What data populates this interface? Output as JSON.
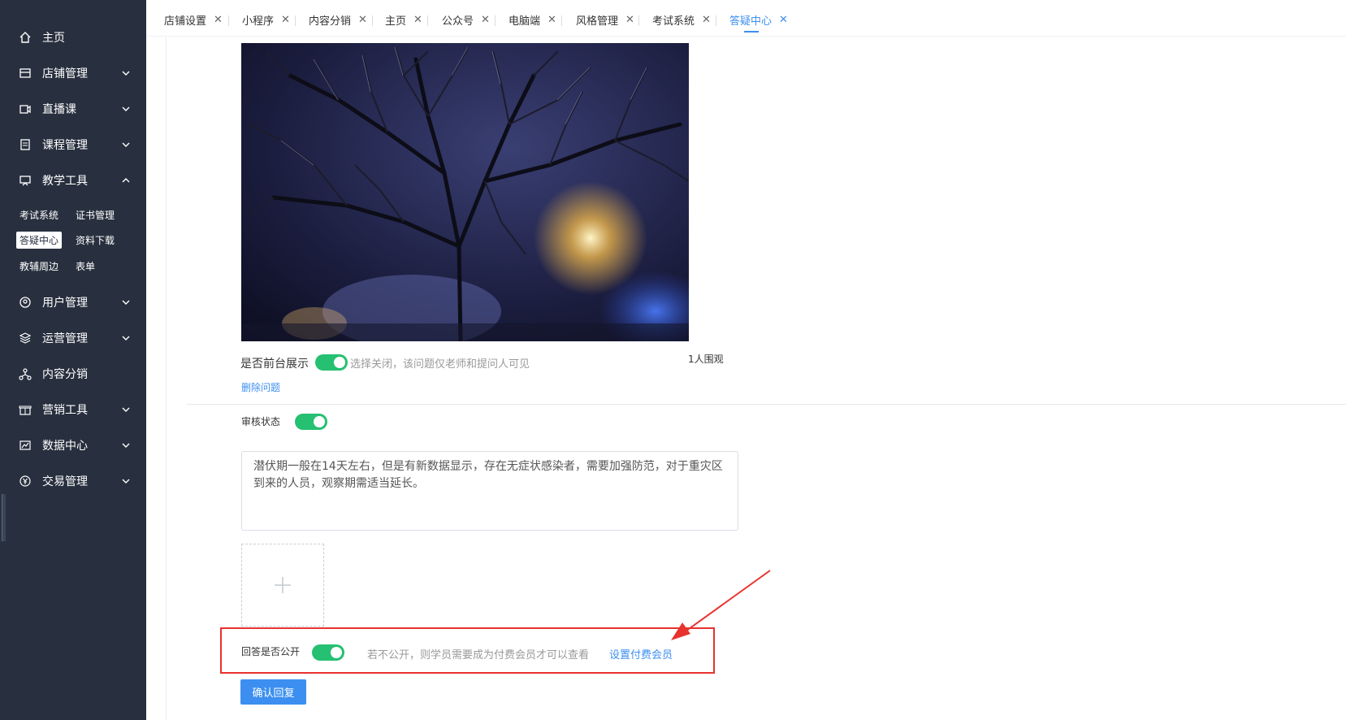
{
  "sidebar": {
    "items": [
      {
        "label": "主页",
        "icon": "home-icon"
      },
      {
        "label": "店铺管理",
        "icon": "store-icon"
      },
      {
        "label": "直播课",
        "icon": "live-icon"
      },
      {
        "label": "课程管理",
        "icon": "course-icon"
      },
      {
        "label": "教学工具",
        "icon": "teaching-icon"
      },
      {
        "label": "用户管理",
        "icon": "user-icon"
      },
      {
        "label": "运营管理",
        "icon": "layers-icon"
      },
      {
        "label": "内容分销",
        "icon": "distribution-icon"
      },
      {
        "label": "营销工具",
        "icon": "gift-icon"
      },
      {
        "label": "数据中心",
        "icon": "chart-icon"
      },
      {
        "label": "交易管理",
        "icon": "yen-icon"
      }
    ],
    "teaching_sub": [
      "考试系统",
      "证书管理",
      "答疑中心",
      "资料下载",
      "教辅周边",
      "表单"
    ]
  },
  "tabs": [
    "店铺设置",
    "小程序",
    "内容分销",
    "主页",
    "公众号",
    "电脑端",
    "风格管理",
    "考试系统",
    "答疑中心"
  ],
  "question": {
    "show_front_label": "是否前台展示",
    "show_front_hint": "选择关闭，该问题仅老师和提问人可见",
    "watchers": "1人围观",
    "delete_label": "删除问题"
  },
  "answer": {
    "review_label": "审核状态",
    "content": "潜伏期一般在14天左右，但是有新数据显示，存在无症状感染者，需要加强防范，对于重灾区到来的人员，观察期需适当延长。",
    "public_label": "回答是否公开",
    "public_hint": "若不公开，则学员需要成为付费会员才可以查看",
    "paid_member_link": "设置付费会员",
    "confirm_button": "确认回复"
  },
  "colors": {
    "accent": "#3c8ff0",
    "switch_on": "#25c072",
    "highlight": "#e8322e",
    "sidebar_bg": "#28303f"
  }
}
